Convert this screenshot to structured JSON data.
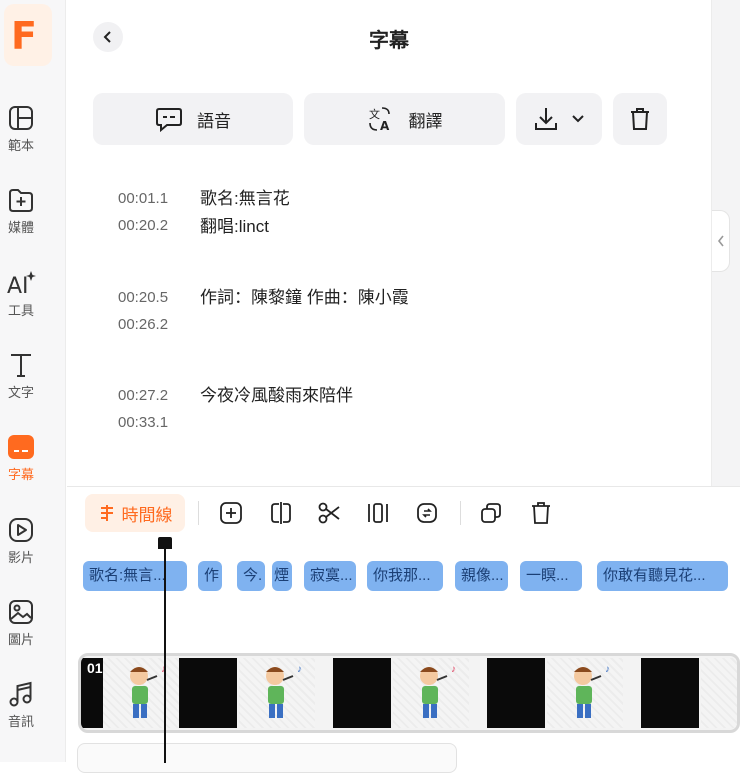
{
  "sidebar": {
    "logo": "F",
    "items": [
      {
        "label": "範本",
        "icon": "template-icon"
      },
      {
        "label": "媒體",
        "icon": "folder-add-icon"
      },
      {
        "label": "工具",
        "icon": "ai-tools-icon"
      },
      {
        "label": "文字",
        "icon": "text-icon"
      },
      {
        "label": "字幕",
        "icon": "subtitle-icon",
        "active": true
      },
      {
        "label": "影片",
        "icon": "video-icon"
      },
      {
        "label": "圖片",
        "icon": "image-icon"
      },
      {
        "label": "音訊",
        "icon": "music-icon"
      }
    ]
  },
  "header": {
    "title": "字幕"
  },
  "actions": {
    "voice_label": "語音",
    "translate_label": "翻譯"
  },
  "subtitles": [
    {
      "start": "00:01.1",
      "end": "00:20.2",
      "lines": [
        "歌名:無言花",
        "翻唱:linct"
      ]
    },
    {
      "start": "00:20.5",
      "end": "00:26.2",
      "lines": [
        "作詞：陳黎鐘 作曲：陳小霞"
      ]
    },
    {
      "start": "00:27.2",
      "end": "00:33.1",
      "lines": [
        "今夜冷風酸雨來陪伴"
      ]
    }
  ],
  "timeline": {
    "tab_label": "時間線",
    "clip_number": "01",
    "chips": [
      "歌名:無言...",
      "作",
      "今.",
      "煙",
      "寂寞...",
      "你我那...",
      "親像...",
      "一瞑...",
      "你敢有聽見花..."
    ]
  },
  "colors": {
    "accent": "#ff6a1f",
    "chip": "#7fb2f0"
  }
}
